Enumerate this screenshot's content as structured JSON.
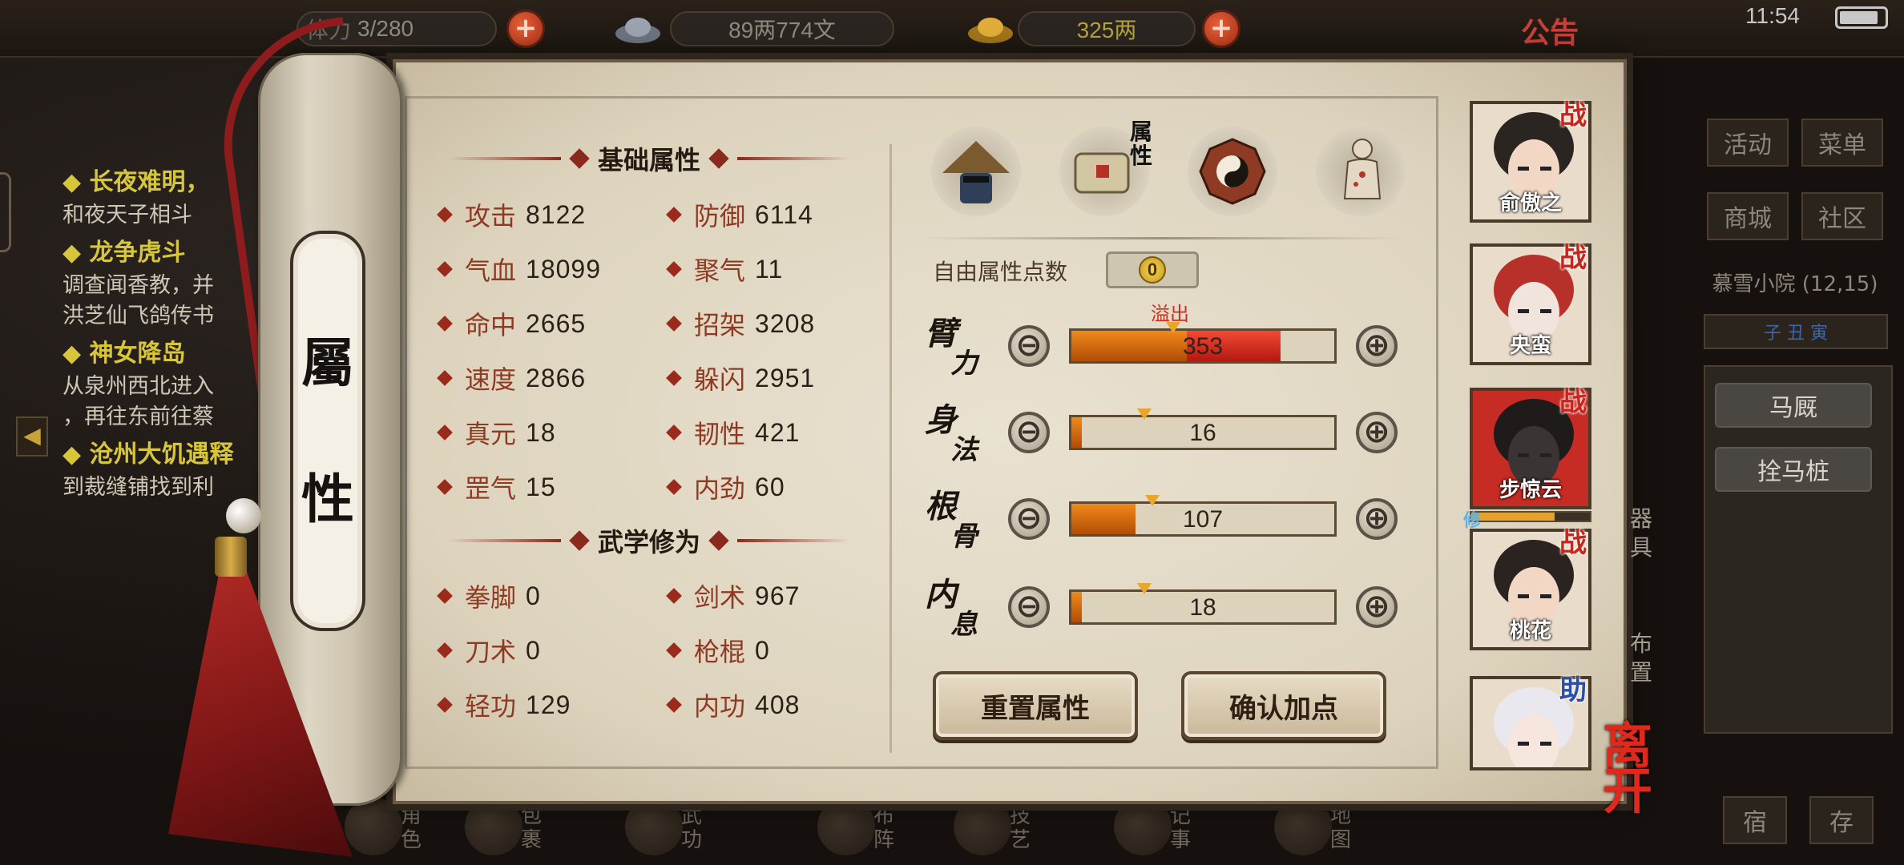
{
  "top_bar": {
    "stamina": "3/280",
    "stamina_prefix": "体力",
    "money": "89两774文",
    "gold": "325两",
    "notice": "公告",
    "clock": "11:54"
  },
  "quests": [
    {
      "title": "长夜难明，",
      "desc": "和夜天子相斗"
    },
    {
      "title": "龙争虎斗",
      "desc": "调查闻香教，并",
      "desc2": "洪芝仙飞鸽传书"
    },
    {
      "title": "神女降岛",
      "desc": "从泉州西北进入",
      "desc2": "，再往东前往蔡"
    },
    {
      "title": "沧州大饥遇释",
      "desc": "到裁缝铺找到利"
    }
  ],
  "right_menu": {
    "activity": "活动",
    "menu": "菜单",
    "shop": "商城",
    "community": "社区",
    "location": "慕雪小院 (12,15)",
    "time_marks": "子 丑 寅",
    "stable": "马厩",
    "hitch": "拴马桩",
    "bottom_a": "宿",
    "bottom_b": "存"
  },
  "dock": [
    {
      "icon": "role-icon",
      "label": "角色"
    },
    {
      "icon": "bag-icon",
      "label": "包裹"
    },
    {
      "icon": "martial-icon",
      "label": "武功"
    },
    {
      "icon": "formation-icon",
      "label": "布阵"
    },
    {
      "icon": "skill-icon",
      "label": "技艺"
    },
    {
      "icon": "journal-icon",
      "label": "记事"
    },
    {
      "icon": "map-icon",
      "label": "地图"
    }
  ],
  "scroll_title": [
    "屬",
    "性"
  ],
  "basic": {
    "heading": "基础属性",
    "stats": [
      {
        "label": "攻击",
        "value": "8122"
      },
      {
        "label": "防御",
        "value": "6114"
      },
      {
        "label": "气血",
        "value": "18099"
      },
      {
        "label": "聚气",
        "value": "11"
      },
      {
        "label": "命中",
        "value": "2665"
      },
      {
        "label": "招架",
        "value": "3208"
      },
      {
        "label": "速度",
        "value": "2866"
      },
      {
        "label": "躲闪",
        "value": "2951"
      },
      {
        "label": "真元",
        "value": "18"
      },
      {
        "label": "韧性",
        "value": "421"
      },
      {
        "label": "罡气",
        "value": "15"
      },
      {
        "label": "内劲",
        "value": "60"
      }
    ]
  },
  "martial": {
    "heading": "武学修为",
    "stats": [
      {
        "label": "拳脚",
        "value": "0"
      },
      {
        "label": "剑术",
        "value": "967"
      },
      {
        "label": "刀术",
        "value": "0"
      },
      {
        "label": "枪棍",
        "value": "0"
      },
      {
        "label": "轻功",
        "value": "129"
      },
      {
        "label": "内功",
        "value": "408"
      }
    ]
  },
  "tabs": {
    "active_label": "属性",
    "icons": [
      "swordsman-hat-icon",
      "scroll-attributes-icon",
      "bagua-icon",
      "meridian-body-icon"
    ]
  },
  "free_points": {
    "label": "自由属性点数",
    "value": "0"
  },
  "overflow_label": "溢出",
  "attributes": [
    {
      "name": [
        "臂",
        "力"
      ],
      "value": "353",
      "fill": 0.43,
      "over": 0.78,
      "mark": 0.39
    },
    {
      "name": [
        "身",
        "法"
      ],
      "value": "16",
      "fill": 0.04,
      "over": 0,
      "mark": 0.28
    },
    {
      "name": [
        "根",
        "骨"
      ],
      "value": "107",
      "fill": 0.24,
      "over": 0,
      "mark": 0.31
    },
    {
      "name": [
        "内",
        "息"
      ],
      "value": "18",
      "fill": 0.04,
      "over": 0,
      "mark": 0.28
    }
  ],
  "buttons": {
    "reset": "重置属性",
    "confirm": "确认加点",
    "minus": "⊖",
    "plus": "⊕"
  },
  "party": [
    {
      "name": "俞傲之",
      "badge": "战"
    },
    {
      "name": "央蛮",
      "badge": "战"
    },
    {
      "name": "步惊云",
      "badge": "战",
      "selected": true,
      "xp": 0.7,
      "xiu": "修"
    },
    {
      "name": "桃花",
      "badge": "战"
    },
    {
      "name": "",
      "badge": "助"
    }
  ],
  "side_labels": {
    "equip": "器具",
    "layout": "布置",
    "leave": "离开"
  },
  "colors": {
    "accent_red": "#8a2a1c",
    "bar_orange": "#f1891b",
    "bar_red": "#f24a35",
    "parchment": "#e9e2d1"
  }
}
